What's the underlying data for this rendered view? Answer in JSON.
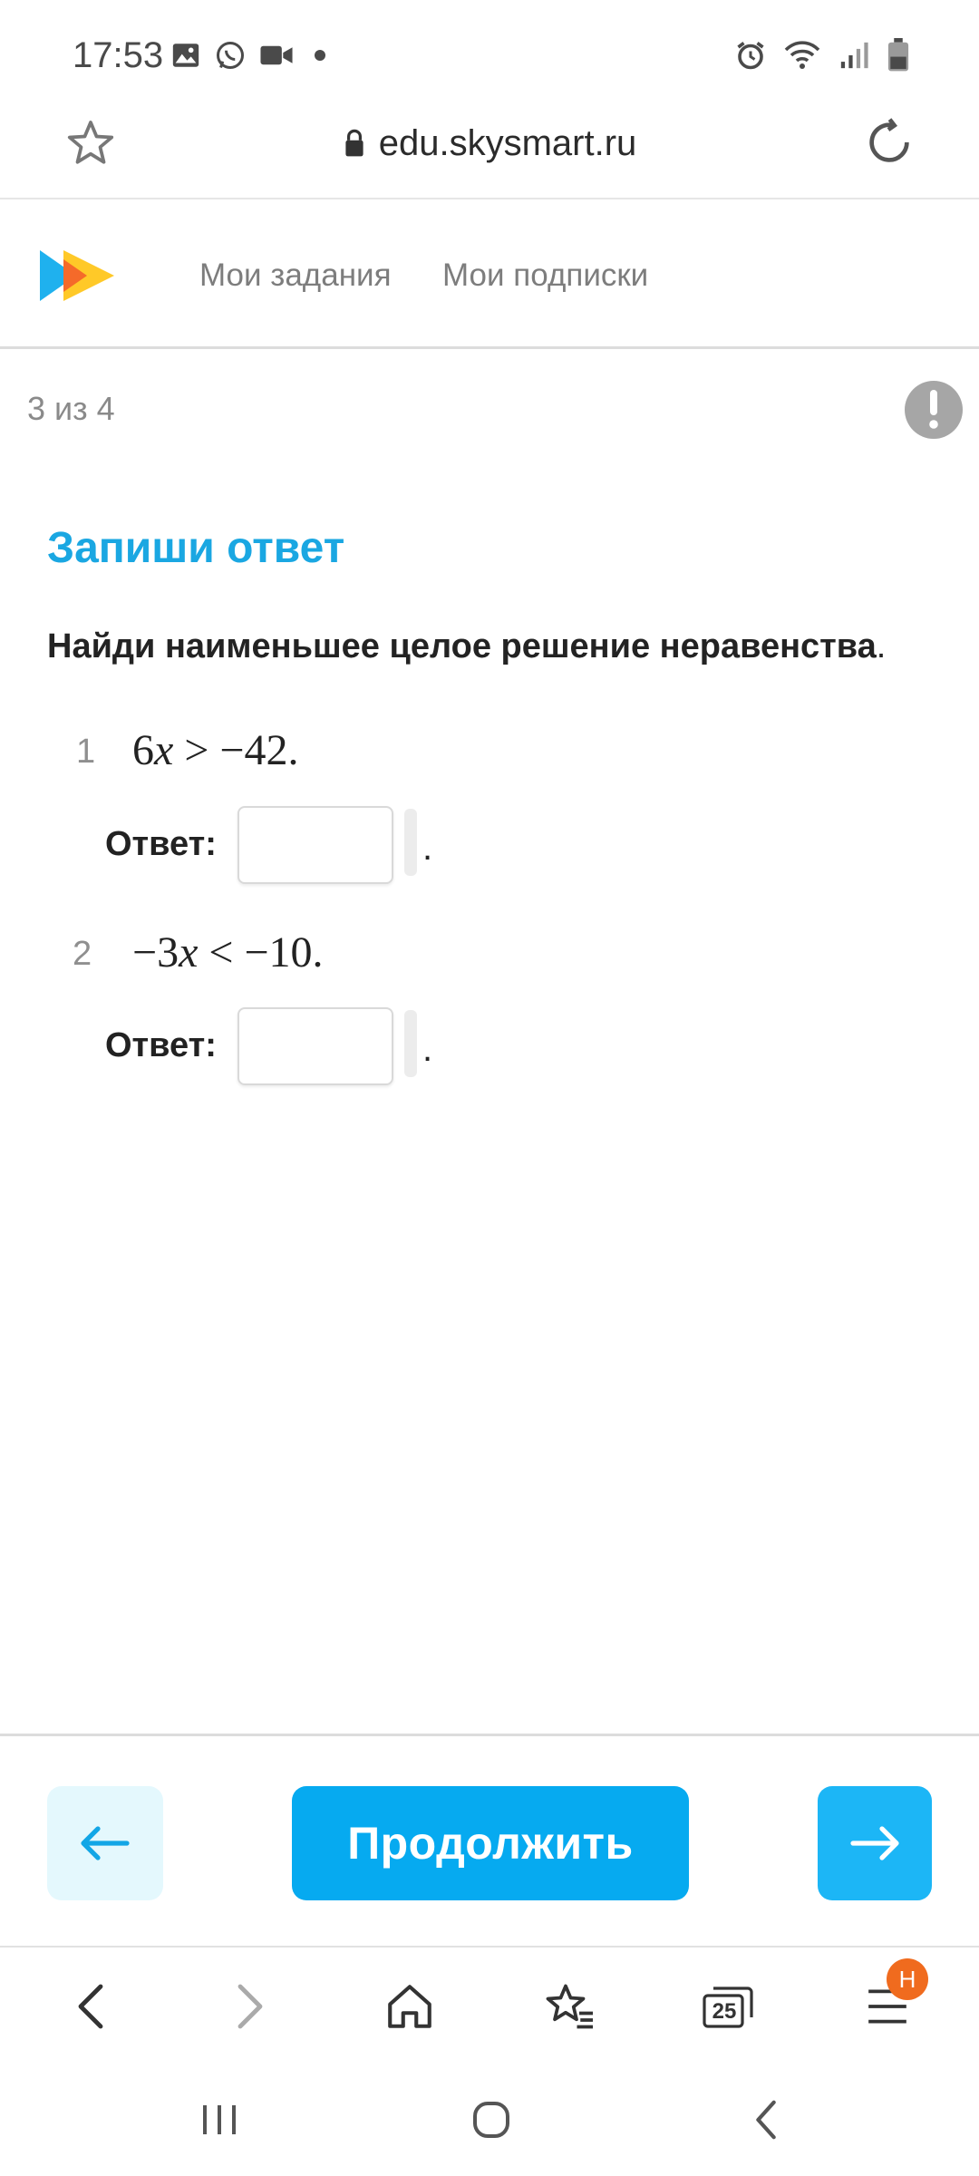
{
  "status_bar": {
    "time": "17:53",
    "left_icons": [
      "gallery-icon",
      "whatsapp-icon",
      "video-icon",
      "dot-icon"
    ],
    "right_icons": [
      "alarm-icon",
      "wifi-icon",
      "signal-icon",
      "battery-icon"
    ]
  },
  "browser": {
    "url": "edu.skysmart.ru",
    "tabs_count": "25",
    "menu_badge": "H"
  },
  "site_nav": {
    "items": [
      "Мои задания",
      "Мои подписки"
    ]
  },
  "progress": {
    "text": "3 из 4"
  },
  "task": {
    "heading": "Запиши ответ",
    "instruction": "Найди наименьшее целое решение неравенства",
    "instruction_end": ".",
    "questions": [
      {
        "number": "1",
        "expr_prefix": "6",
        "expr_var": "x",
        "expr_suffix": " > −42.",
        "answer_label": "Ответ:",
        "answer_value": "",
        "after_input": "."
      },
      {
        "number": "2",
        "expr_prefix": "−3",
        "expr_var": "x",
        "expr_suffix": " < −10.",
        "answer_label": "Ответ:",
        "answer_value": "",
        "after_input": "."
      }
    ]
  },
  "actions": {
    "continue_label": "Продолжить"
  },
  "colors": {
    "accent": "#06aaf0",
    "heading": "#1aa7e2",
    "back_button_bg": "#e4f8fd",
    "badge": "#f06b1e"
  }
}
